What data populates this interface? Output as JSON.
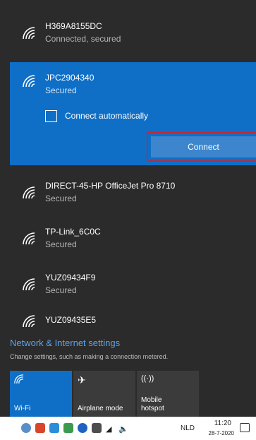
{
  "networks_top": [
    {
      "name": "H369A8155DC",
      "status": "Connected, secured"
    }
  ],
  "selected_network": {
    "name": "JPC2904340",
    "status": "Secured",
    "auto_connect_label": "Connect automatically",
    "connect_label": "Connect"
  },
  "networks_bottom": [
    {
      "name": "DIRECT-45-HP OfficeJet Pro 8710",
      "status": "Secured"
    },
    {
      "name": "TP-Link_6C0C",
      "status": "Secured"
    },
    {
      "name": "YUZ09434F9",
      "status": "Secured"
    },
    {
      "name": "YUZ09435E5",
      "status": ""
    }
  ],
  "settings": {
    "link": "Network & Internet settings",
    "description": "Change settings, such as making a connection metered."
  },
  "quick_actions": [
    {
      "icon": "wifi-icon",
      "label": "Wi-Fi",
      "active": true
    },
    {
      "icon": "airplane-icon",
      "label": "Airplane mode",
      "active": false
    },
    {
      "icon": "hotspot-icon",
      "label": "Mobile hotspot",
      "active": false
    }
  ],
  "taskbar": {
    "language": "NLD",
    "time": "11:20",
    "date": "28-7-2020"
  },
  "colors": {
    "accent": "#0f6fc6",
    "panel": "#2b2b2b",
    "link": "#5aa5ed",
    "highlight_border": "#c0293b"
  }
}
